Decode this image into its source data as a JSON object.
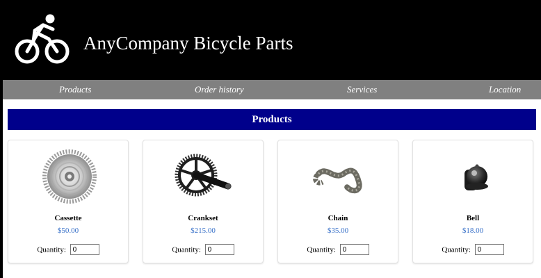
{
  "header": {
    "title": "AnyCompany Bicycle Parts",
    "logo_icon": "cyclist-icon"
  },
  "nav": {
    "items": [
      "Products",
      "Order history",
      "Services",
      "Location"
    ]
  },
  "section": {
    "title": "Products"
  },
  "products": [
    {
      "name": "Cassette",
      "price": "$50.00",
      "qty_label": "Quantity:",
      "qty": "0",
      "icon": "cassette-icon"
    },
    {
      "name": "Crankset",
      "price": "$215.00",
      "qty_label": "Quantity:",
      "qty": "0",
      "icon": "crankset-icon"
    },
    {
      "name": "Chain",
      "price": "$35.00",
      "qty_label": "Quantity:",
      "qty": "0",
      "icon": "chain-icon"
    },
    {
      "name": "Bell",
      "price": "$18.00",
      "qty_label": "Quantity:",
      "qty": "0",
      "icon": "bell-icon"
    }
  ],
  "colors": {
    "header_bg": "#000000",
    "nav_bg": "#808080",
    "section_bg": "#00008b",
    "price": "#3a72c9"
  }
}
